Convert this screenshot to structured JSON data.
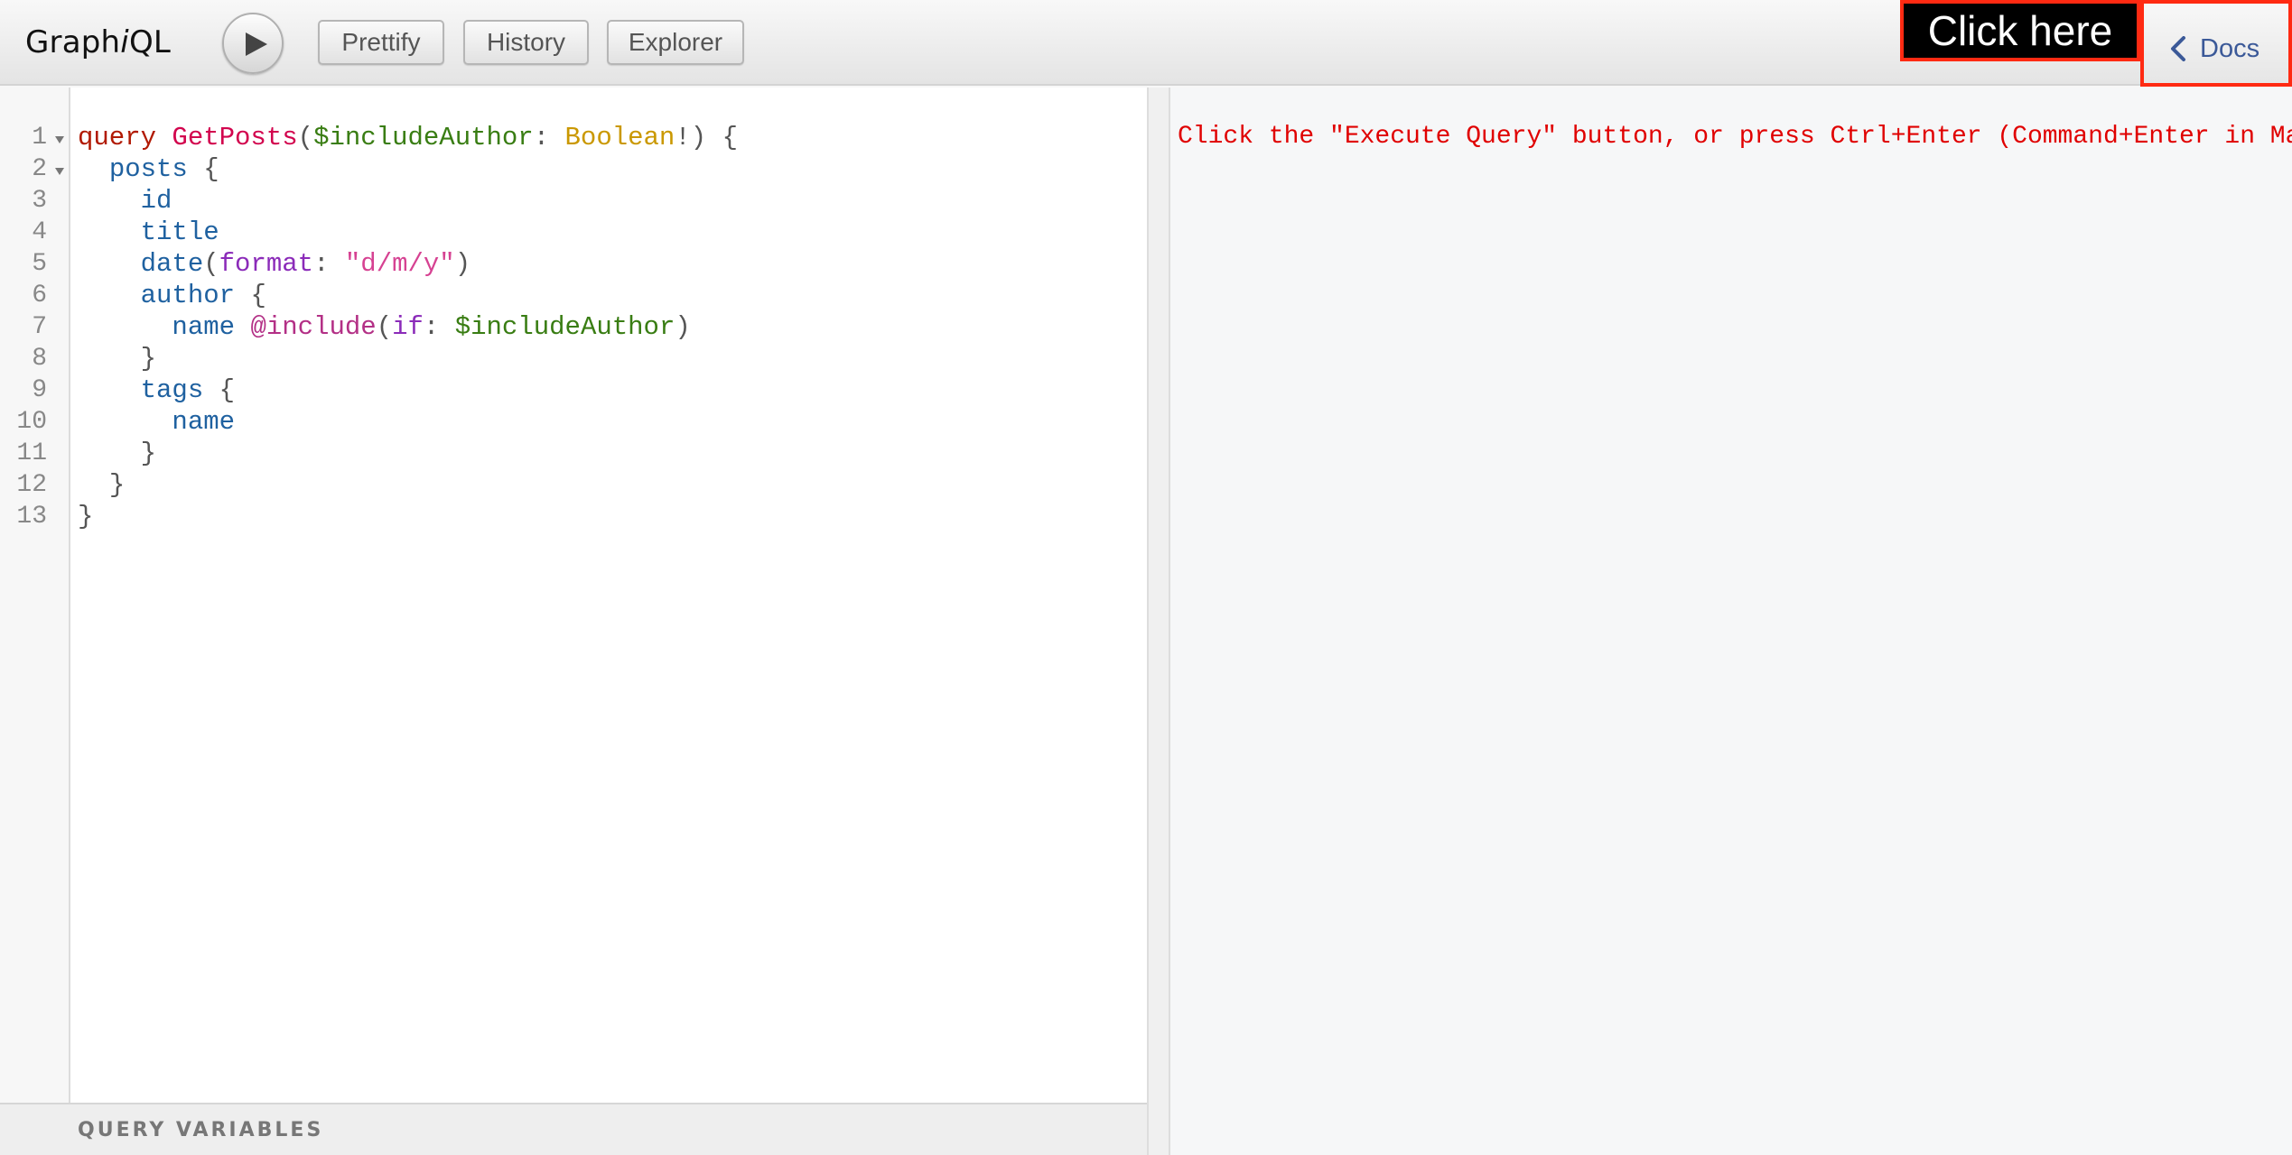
{
  "app": {
    "logo_prefix": "Graph",
    "logo_italic": "i",
    "logo_suffix": "QL"
  },
  "toolbar": {
    "execute_icon": "play-icon",
    "prettify_label": "Prettify",
    "history_label": "History",
    "explorer_label": "Explorer",
    "docs_label": "Docs",
    "docs_icon": "chevron-left-icon"
  },
  "annotation": {
    "text": "Click here",
    "highlight_color": "#ff2a12"
  },
  "editor": {
    "line_numbers": [
      "1",
      "2",
      "3",
      "4",
      "5",
      "6",
      "7",
      "8",
      "9",
      "10",
      "11",
      "12",
      "13"
    ],
    "lines": [
      "query GetPosts($includeAuthor: Boolean!) {",
      "  posts {",
      "    id",
      "    title",
      "    date(format: \"d/m/y\")",
      "    author {",
      "      name @include(if: $includeAuthor)",
      "    }",
      "    tags {",
      "      name",
      "    }",
      "  }",
      "}"
    ],
    "folded_lines": [
      1,
      2
    ],
    "query_variables_label": "QUERY VARIABLES"
  },
  "result": {
    "message": "Click the \"Execute Query\" button, or press Ctrl+Enter (Command+Enter in Mac)",
    "message_color": "#e00000"
  },
  "colors": {
    "keyword": "#b11a04",
    "definition": "#d2054e",
    "variable": "#397d13",
    "type": "#ca9800",
    "field": "#1f61a0",
    "argument": "#8b2bb9",
    "string": "#d64292",
    "directive": "#b33086"
  }
}
